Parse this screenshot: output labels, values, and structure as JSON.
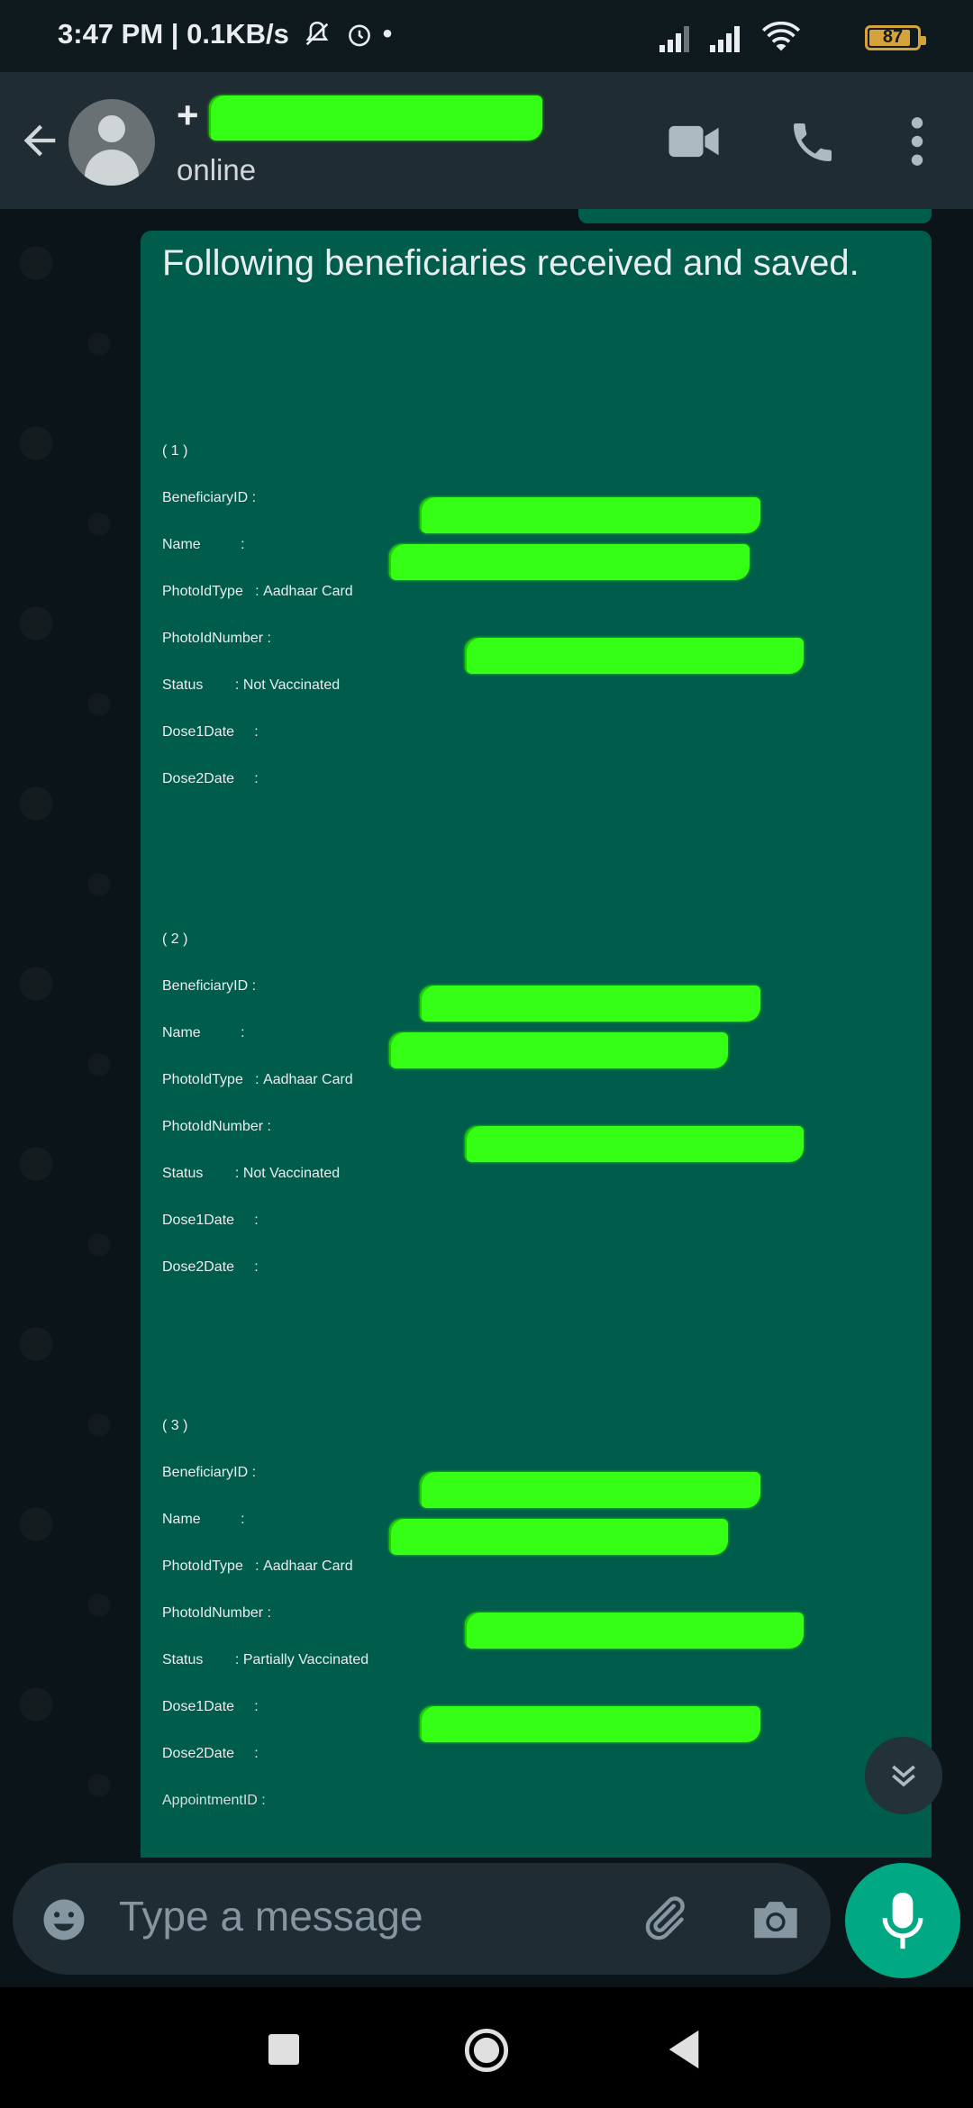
{
  "status_bar": {
    "time": "3:47 PM",
    "speed": "0.1KB/s",
    "battery": "87",
    "battery_level": 0.87
  },
  "header": {
    "contact_prefix": "+",
    "contact_status": "online"
  },
  "message": {
    "intro": "Following beneficiaries received and saved.",
    "entries": [
      {
        "index": "( 1 )",
        "beneficiary_label": "BeneficiaryID :",
        "name_label": "Name          :",
        "photo_type_label": "PhotoIdType   :",
        "photo_type_value": "Aadhaar Card",
        "photo_number_label": "PhotoIdNumber :",
        "status_label": "Status        :",
        "status_value": "Not Vaccinated",
        "dose1_label": "Dose1Date     :",
        "dose2_label": "Dose2Date     :"
      },
      {
        "index": "( 2 )",
        "beneficiary_label": "BeneficiaryID :",
        "name_label": "Name          :",
        "photo_type_label": "PhotoIdType   :",
        "photo_type_value": "Aadhaar Card",
        "photo_number_label": "PhotoIdNumber :",
        "status_label": "Status        :",
        "status_value": "Not Vaccinated",
        "dose1_label": "Dose1Date     :",
        "dose2_label": "Dose2Date     :"
      },
      {
        "index": "( 3 )",
        "beneficiary_label": "BeneficiaryID :",
        "name_label": "Name          :",
        "photo_type_label": "PhotoIdType   :",
        "photo_type_value": "Aadhaar Card",
        "photo_number_label": "PhotoIdNumber :",
        "status_label": "Status        :",
        "status_value": "Partially Vaccinated",
        "dose1_label": "Dose1Date     :",
        "dose2_label": "Dose2Date     :",
        "appointment_label": "AppointmentID :"
      }
    ]
  },
  "composer": {
    "placeholder": "Type a message"
  },
  "colors": {
    "bubble": "#005c4b",
    "header": "#1f2c33",
    "accent": "#00a884",
    "redaction": "#34ff14"
  },
  "icons": [
    "back-arrow-icon",
    "avatar-icon",
    "video-call-icon",
    "phone-call-icon",
    "more-options-icon",
    "scroll-down-icon",
    "emoji-icon",
    "attach-icon",
    "camera-icon",
    "mic-icon",
    "nav-recents-icon",
    "nav-home-icon",
    "nav-back-icon"
  ]
}
